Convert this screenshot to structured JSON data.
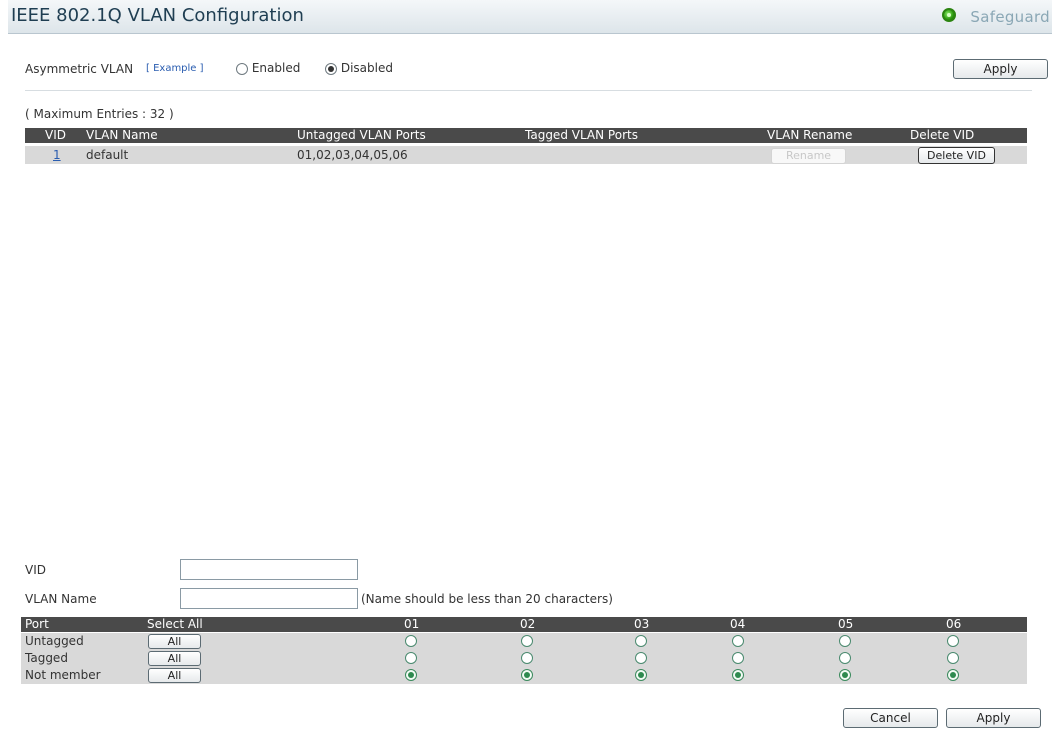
{
  "header": {
    "title": "IEEE 802.1Q VLAN Configuration",
    "brand": "Safeguard",
    "brand_icon": "safeguard-status-icon"
  },
  "asymmetric": {
    "label": "Asymmetric VLAN",
    "example_link": "[ Example ]",
    "options": [
      "Enabled",
      "Disabled"
    ],
    "selected": "Disabled",
    "apply_label": "Apply"
  },
  "table": {
    "max_entries": "( Maximum Entries : 32 )",
    "columns": [
      "VID",
      "VLAN Name",
      "Untagged VLAN Ports",
      "Tagged VLAN Ports",
      "VLAN Rename",
      "Delete VID"
    ],
    "rows": [
      {
        "vid": "1",
        "name": "default",
        "untagged": "01,02,03,04,05,06",
        "tagged": "",
        "rename_label": "Rename",
        "delete_label": "Delete VID"
      }
    ]
  },
  "form": {
    "vid_label": "VID",
    "vid_value": "",
    "name_label": "VLAN Name",
    "name_value": "",
    "name_hint": "(Name should be less than 20 characters)"
  },
  "ports": {
    "header": [
      "Port",
      "Select All",
      "01",
      "02",
      "03",
      "04",
      "05",
      "06"
    ],
    "rows": [
      {
        "label": "Untagged",
        "all_label": "All",
        "selected": [
          false,
          false,
          false,
          false,
          false,
          false
        ]
      },
      {
        "label": "Tagged",
        "all_label": "All",
        "selected": [
          false,
          false,
          false,
          false,
          false,
          false
        ]
      },
      {
        "label": "Not member",
        "all_label": "All",
        "selected": [
          true,
          true,
          true,
          true,
          true,
          true
        ]
      }
    ]
  },
  "footer": {
    "cancel_label": "Cancel",
    "apply_label": "Apply"
  },
  "colors": {
    "header_dark": "#4a4a4a",
    "row_gray": "#d9d9d9",
    "title_blue": "#1f3e52",
    "brand_green": "#2e9a11"
  }
}
